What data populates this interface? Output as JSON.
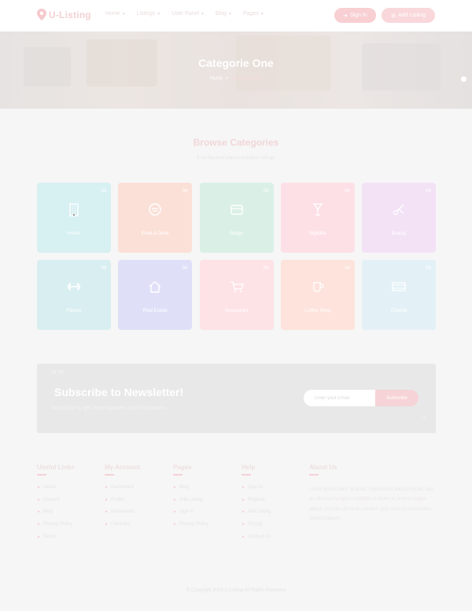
{
  "header": {
    "logo_text": "U-Listing",
    "nav": [
      {
        "label": "Home",
        "has_caret": true
      },
      {
        "label": "Listings",
        "has_caret": true
      },
      {
        "label": "User Panel",
        "has_caret": true
      },
      {
        "label": "Blog",
        "has_caret": true
      },
      {
        "label": "Pages",
        "has_caret": true
      }
    ],
    "signin_label": "Sign In",
    "add_listing_label": "Add Listing",
    "accent_color": "#f8cfd2"
  },
  "hero": {
    "title": "Categorie One",
    "breadcrumb": [
      "Home",
      "Categorie One"
    ]
  },
  "categories": {
    "title": "Browse Categories",
    "subtitle": "Find the best places and best listings",
    "items": [
      {
        "name": "Hotels",
        "count": "04",
        "icon": "building-icon",
        "color": "#d7f0f2"
      },
      {
        "name": "Food & Drink",
        "count": "04",
        "icon": "restaurant-icon",
        "color": "#fbe0d8"
      },
      {
        "name": "Shops",
        "count": "04",
        "icon": "shop-icon",
        "color": "#daf0e6"
      },
      {
        "name": "Nightlife",
        "count": "04",
        "icon": "glass-icon",
        "color": "#fde0e6"
      },
      {
        "name": "Beauty",
        "count": "04",
        "icon": "scissors-icon",
        "color": "#f3e2f6"
      },
      {
        "name": "Fitness",
        "count": "04",
        "icon": "dumbbell-icon",
        "color": "#d9eef0"
      },
      {
        "name": "Real Estate",
        "count": "04",
        "icon": "house-icon",
        "color": "#dfe0f8"
      },
      {
        "name": "Restaurant",
        "count": "04",
        "icon": "cart-icon",
        "color": "#fde2e6"
      },
      {
        "name": "Coffee Shop",
        "count": "04",
        "icon": "cup-icon",
        "color": "#fde3dc"
      },
      {
        "name": "Cinema",
        "count": "04",
        "icon": "film-icon",
        "color": "#e3f1f7"
      }
    ]
  },
  "newsletter": {
    "title": "Subscribe to Newsletter!",
    "text": "Subscribe to get latest updates and information.",
    "placeholder": "Enter your Email",
    "button_label": "Subscribe"
  },
  "footer": {
    "columns": [
      {
        "heading": "Useful Links",
        "links": [
          "About",
          "Contact",
          "Blog",
          "Privacy Policy",
          "Terms"
        ]
      },
      {
        "heading": "My Account",
        "links": [
          "Dashboard",
          "Profile",
          "Bookmarks",
          "Favorites"
        ]
      },
      {
        "heading": "Pages",
        "links": [
          "Blog",
          "Add Listing",
          "Sign In",
          "Privacy Policy"
        ]
      },
      {
        "heading": "Help",
        "links": [
          "Sign In",
          "Register",
          "Add Listing",
          "Pricing",
          "Contact Us"
        ]
      }
    ],
    "about": {
      "heading": "About Us",
      "text": "Lorem ipsum dolor sit amet, consectetur adipiscing elit, sed do eiusmod tempor incididunt ut labore et dolore magna aliqua. Ut enim ad minim veniam, quis nostrud exercitation ullamco laboris."
    },
    "copyright": "© Copyright 2019 U-Listing All Rights Reserved"
  }
}
